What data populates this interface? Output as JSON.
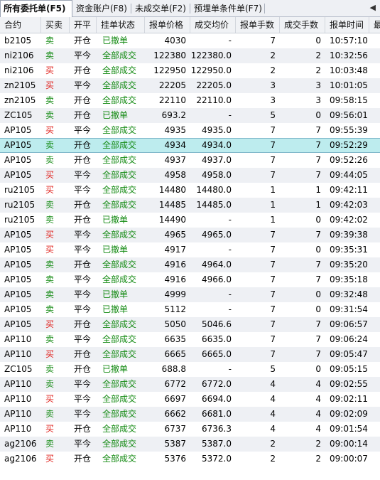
{
  "tabs": [
    {
      "label": "所有委托单(F5)",
      "active": true
    },
    {
      "label": "资金账户(F8)",
      "active": false
    },
    {
      "label": "未成交单(F2)",
      "active": false
    },
    {
      "label": "预埋单条件单(F7)",
      "active": false
    }
  ],
  "scroll_left_glyph": "◀",
  "headers": [
    "合约",
    "买卖",
    "开平",
    "挂单状态",
    "报单价格",
    "成交均价",
    "报单手数",
    "成交手数",
    "报单时间",
    "最"
  ],
  "colors": {
    "buy": "#e0201b",
    "sell": "#138a12",
    "status": "#138a12",
    "selected_row": "#bdecee"
  },
  "selected_row_index": 7,
  "rows": [
    [
      "b2105",
      "卖",
      "开仓",
      "已撤单",
      "4030",
      "-",
      "7",
      "0",
      "10:57:10"
    ],
    [
      "ni2106",
      "卖",
      "平今",
      "全部成交",
      "122380",
      "122380.0",
      "2",
      "2",
      "10:32:56"
    ],
    [
      "ni2106",
      "买",
      "开仓",
      "全部成交",
      "122950",
      "122950.0",
      "2",
      "2",
      "10:03:48"
    ],
    [
      "zn2105",
      "买",
      "平今",
      "全部成交",
      "22205",
      "22205.0",
      "3",
      "3",
      "10:01:05"
    ],
    [
      "zn2105",
      "卖",
      "开仓",
      "全部成交",
      "22110",
      "22110.0",
      "3",
      "3",
      "09:58:15"
    ],
    [
      "ZC105",
      "卖",
      "开仓",
      "已撤单",
      "693.2",
      "-",
      "5",
      "0",
      "09:56:01"
    ],
    [
      "AP105",
      "买",
      "平今",
      "全部成交",
      "4935",
      "4935.0",
      "7",
      "7",
      "09:55:39"
    ],
    [
      "AP105",
      "卖",
      "开仓",
      "全部成交",
      "4934",
      "4934.0",
      "7",
      "7",
      "09:52:29"
    ],
    [
      "AP105",
      "卖",
      "开仓",
      "全部成交",
      "4937",
      "4937.0",
      "7",
      "7",
      "09:52:26"
    ],
    [
      "AP105",
      "买",
      "平今",
      "全部成交",
      "4958",
      "4958.0",
      "7",
      "7",
      "09:44:05"
    ],
    [
      "ru2105",
      "买",
      "平今",
      "全部成交",
      "14480",
      "14480.0",
      "1",
      "1",
      "09:42:11"
    ],
    [
      "ru2105",
      "卖",
      "开仓",
      "全部成交",
      "14485",
      "14485.0",
      "1",
      "1",
      "09:42:03"
    ],
    [
      "ru2105",
      "卖",
      "开仓",
      "已撤单",
      "14490",
      "-",
      "1",
      "0",
      "09:42:02"
    ],
    [
      "AP105",
      "买",
      "平今",
      "全部成交",
      "4965",
      "4965.0",
      "7",
      "7",
      "09:39:38"
    ],
    [
      "AP105",
      "买",
      "平今",
      "已撤单",
      "4917",
      "-",
      "7",
      "0",
      "09:35:31"
    ],
    [
      "AP105",
      "卖",
      "开仓",
      "全部成交",
      "4916",
      "4964.0",
      "7",
      "7",
      "09:35:20"
    ],
    [
      "AP105",
      "卖",
      "平今",
      "全部成交",
      "4916",
      "4966.0",
      "7",
      "7",
      "09:35:18"
    ],
    [
      "AP105",
      "卖",
      "平今",
      "已撤单",
      "4999",
      "-",
      "7",
      "0",
      "09:32:48"
    ],
    [
      "AP105",
      "卖",
      "平今",
      "已撤单",
      "5112",
      "-",
      "7",
      "0",
      "09:31:54"
    ],
    [
      "AP105",
      "买",
      "开仓",
      "全部成交",
      "5050",
      "5046.6",
      "7",
      "7",
      "09:06:57"
    ],
    [
      "AP110",
      "卖",
      "平今",
      "全部成交",
      "6635",
      "6635.0",
      "7",
      "7",
      "09:06:24"
    ],
    [
      "AP110",
      "买",
      "开仓",
      "全部成交",
      "6665",
      "6665.0",
      "7",
      "7",
      "09:05:47"
    ],
    [
      "ZC105",
      "卖",
      "开仓",
      "已撤单",
      "688.8",
      "-",
      "5",
      "0",
      "09:05:15"
    ],
    [
      "AP110",
      "卖",
      "平今",
      "全部成交",
      "6772",
      "6772.0",
      "4",
      "4",
      "09:02:55"
    ],
    [
      "AP110",
      "买",
      "平今",
      "全部成交",
      "6697",
      "6694.0",
      "4",
      "4",
      "09:02:11"
    ],
    [
      "AP110",
      "卖",
      "平今",
      "全部成交",
      "6662",
      "6681.0",
      "4",
      "4",
      "09:02:09"
    ],
    [
      "AP110",
      "买",
      "开仓",
      "全部成交",
      "6737",
      "6736.3",
      "4",
      "4",
      "09:01:54"
    ],
    [
      "ag2106",
      "卖",
      "平今",
      "全部成交",
      "5387",
      "5387.0",
      "2",
      "2",
      "09:00:14"
    ],
    [
      "ag2106",
      "买",
      "开仓",
      "全部成交",
      "5376",
      "5372.0",
      "2",
      "2",
      "09:00:07"
    ]
  ]
}
